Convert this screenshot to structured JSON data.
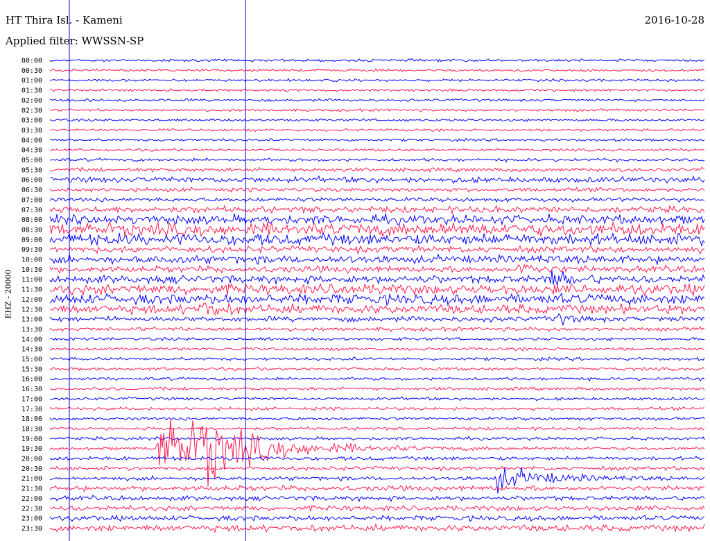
{
  "header": {
    "station": "HT Thira Isl. - Kameni",
    "date": "2016-10-28",
    "filter": "Applied filter: WWSSN-SP"
  },
  "channel_label": "EHZ - 20000",
  "colors": {
    "trace_a": "#0000ff",
    "trace_b": "#ff1a4d",
    "marker": "#0000cc"
  },
  "chart_data": {
    "type": "line",
    "title": "HT Thira Isl. - Kameni",
    "subtitle": "Applied filter: WWSSN-SP",
    "ylabel": "EHZ - 20000",
    "row_labels": [
      "00:00",
      "00:30",
      "01:00",
      "01:30",
      "02:00",
      "02:30",
      "03:00",
      "03:30",
      "04:00",
      "04:30",
      "05:00",
      "05:30",
      "06:00",
      "06:30",
      "07:00",
      "07:30",
      "08:00",
      "08:30",
      "09:00",
      "09:30",
      "10:00",
      "10:30",
      "11:00",
      "11:30",
      "12:00",
      "12:30",
      "13:00",
      "13:30",
      "14:00",
      "14:30",
      "15:00",
      "15:30",
      "16:00",
      "16:30",
      "17:00",
      "17:30",
      "18:00",
      "18:30",
      "19:00",
      "19:30",
      "20:00",
      "20:30",
      "21:00",
      "21:30",
      "22:00",
      "22:30",
      "23:00",
      "23:30"
    ],
    "row_noise_level": [
      1,
      1,
      1,
      1,
      1,
      1,
      1,
      1,
      1,
      1,
      1.2,
      1.5,
      2.2,
      1.6,
      1.6,
      2.5,
      3.5,
      5,
      4.5,
      2.5,
      3,
      2.5,
      3,
      4,
      4,
      3.5,
      2,
      1.5,
      1.2,
      1.2,
      1.2,
      1.2,
      1.2,
      1.2,
      1.2,
      1.2,
      1.2,
      1.2,
      1.2,
      1.2,
      1.5,
      1.5,
      1.5,
      2,
      1.8,
      2,
      2,
      2.5
    ],
    "events": [
      {
        "row": "19:30",
        "minute": 5.0,
        "peak": 40,
        "decay_min": 3.5
      },
      {
        "row": "19:30",
        "minute": 6.9,
        "peak": 30,
        "decay_min": 1.2
      },
      {
        "row": "21:00",
        "minute": 20.5,
        "peak": 14,
        "decay_min": 2.0
      },
      {
        "row": "12:30",
        "minute": 7.0,
        "peak": 9,
        "decay_min": 0.8
      },
      {
        "row": "10:30",
        "minute": 21.5,
        "peak": 8,
        "decay_min": 0.7
      },
      {
        "row": "11:00",
        "minute": 23.0,
        "peak": 10,
        "decay_min": 0.8
      },
      {
        "row": "13:00",
        "minute": 23.0,
        "peak": 8,
        "decay_min": 0.6
      }
    ],
    "grid": false
  }
}
